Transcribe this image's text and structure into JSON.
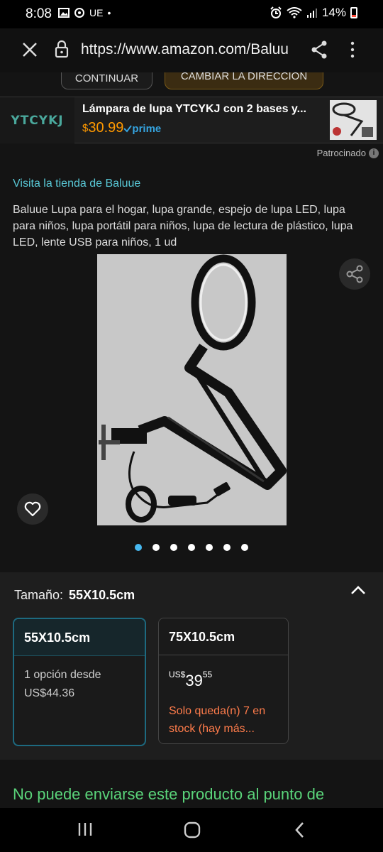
{
  "status": {
    "time": "8:08",
    "carrier_text": "UE",
    "battery": "14%"
  },
  "browser": {
    "url": "https://www.amazon.com/Baluu"
  },
  "address_buttons": {
    "continue": "CONTINUAR",
    "change": "CAMBIAR LA DIRECCIÓN"
  },
  "ad": {
    "brand": "YTCYKJ",
    "title": "Lámpara de lupa YTCYKJ con 2 bases y...",
    "price_symbol": "$",
    "price": "30.99",
    "prime": "prime"
  },
  "product": {
    "sponsored": "Patrocinado",
    "store_link": "Visita la tienda de Baluue",
    "title": "Baluue Lupa para el hogar, lupa grande, espejo de lupa LED, lupa para niños, lupa portátil para niños, lupa de lectura de plástico, lupa LED, lente USB para niños, 1 ud",
    "image_count": 7,
    "active_image": 0
  },
  "size": {
    "label": "Tamaño:",
    "selected": "55X10.5cm",
    "options": [
      {
        "name": "55X10.5cm",
        "line1": "1 opción desde",
        "line2": "US$44.36"
      },
      {
        "name": "75X10.5cm",
        "price_currency": "US$",
        "price_whole": "39",
        "price_fraction": "55",
        "stock": "Solo queda(n) 7 en stock (hay más..."
      }
    ]
  },
  "shipping": {
    "message": "No puede enviarse este producto al punto de"
  },
  "colors": {
    "link": "#59c8d6",
    "price": "#ff9900",
    "prime": "#35a4e0",
    "shipping": "#5ad47a",
    "stock_warning": "#ff7c4b",
    "dot_active": "#47b8f0"
  }
}
